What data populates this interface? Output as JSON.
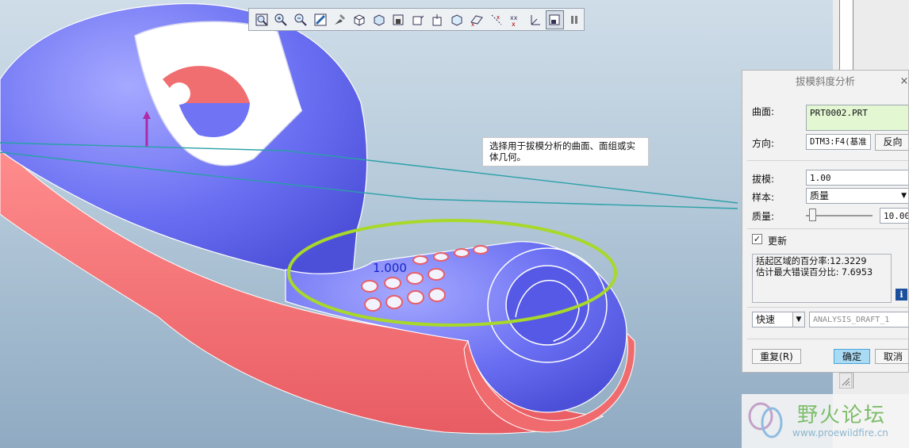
{
  "toolbar": {
    "icons": [
      "zoom-window-icon",
      "zoom-in-icon",
      "zoom-out-icon",
      "refit-icon",
      "repaint-icon",
      "shading-icon",
      "view-manager-icon",
      "saved-views-icon",
      "layers-icon",
      "spin-center-icon",
      "orient-icon",
      "datum-planes-icon",
      "datum-axes-icon",
      "datum-points-icon",
      "coordinate-systems-icon",
      "annotation-icon",
      "pause-icon"
    ]
  },
  "viewport": {
    "tooltip": "选择用于拔模分析的曲面、面组或实体几何。",
    "draft_label": "1.000"
  },
  "dialog": {
    "title": "拔模斜度分析",
    "close": "×",
    "surface_label": "曲面:",
    "surface_value": "PRT0002.PRT",
    "direction_label": "方向:",
    "direction_value": "DTM3:F4(基准",
    "flip_button": "反向",
    "draft_label": "拔模:",
    "draft_value": "1.00",
    "sample_label": "样本:",
    "sample_value": "质量",
    "quality_label": "质量:",
    "quality_value": "10.00",
    "quality_slider": 0.1,
    "update_checked": true,
    "update_label": "更新",
    "result_line1": "括起区域的百分率:12.3229",
    "result_line2": "估计最大错误百分比: 7.6953",
    "mode_value": "快速",
    "analysis_name": "ANALYSIS_DRAFT_1",
    "repeat_button": "重复(R)",
    "ok_button": "确定",
    "cancel_button": "取消"
  },
  "watermark": {
    "name": "野火论坛",
    "url": "www.proewildfire.cn"
  },
  "colors": {
    "model_blue": "#7074f4",
    "model_red": "#f07070",
    "highlight_ring": "#a8d82a",
    "ok_button": "#a9dbf4"
  }
}
